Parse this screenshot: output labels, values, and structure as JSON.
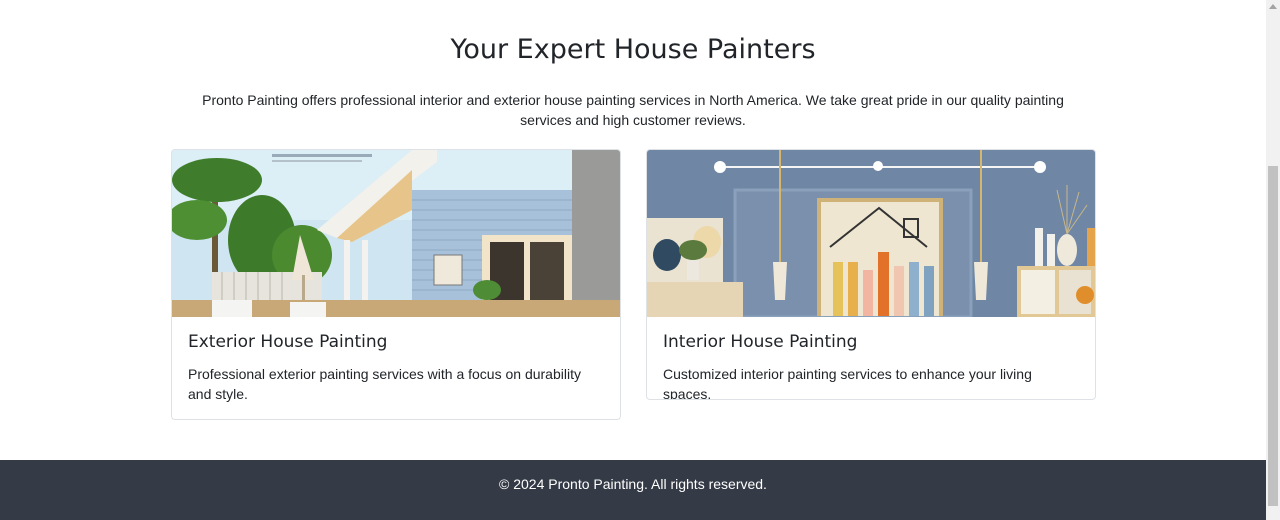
{
  "main": {
    "heading": "Your Expert House Painters",
    "intro": "Pronto Painting offers professional interior and exterior house painting services in North America. We take great pride in our quality painting services and high customer reviews."
  },
  "cards": [
    {
      "title": "Exterior House Painting",
      "text": "Professional exterior painting services with a focus on durability and style.",
      "image": "exterior-house-photo"
    },
    {
      "title": "Interior House Painting",
      "text": "Customized interior painting services to enhance your living spaces.",
      "image": "interior-room-illustration"
    }
  ],
  "footer": {
    "copyright": "© 2024 Pronto Painting. All rights reserved."
  },
  "colors": {
    "footer_bg": "#343a46",
    "text": "#212529",
    "card_border": "#dee2e6"
  }
}
